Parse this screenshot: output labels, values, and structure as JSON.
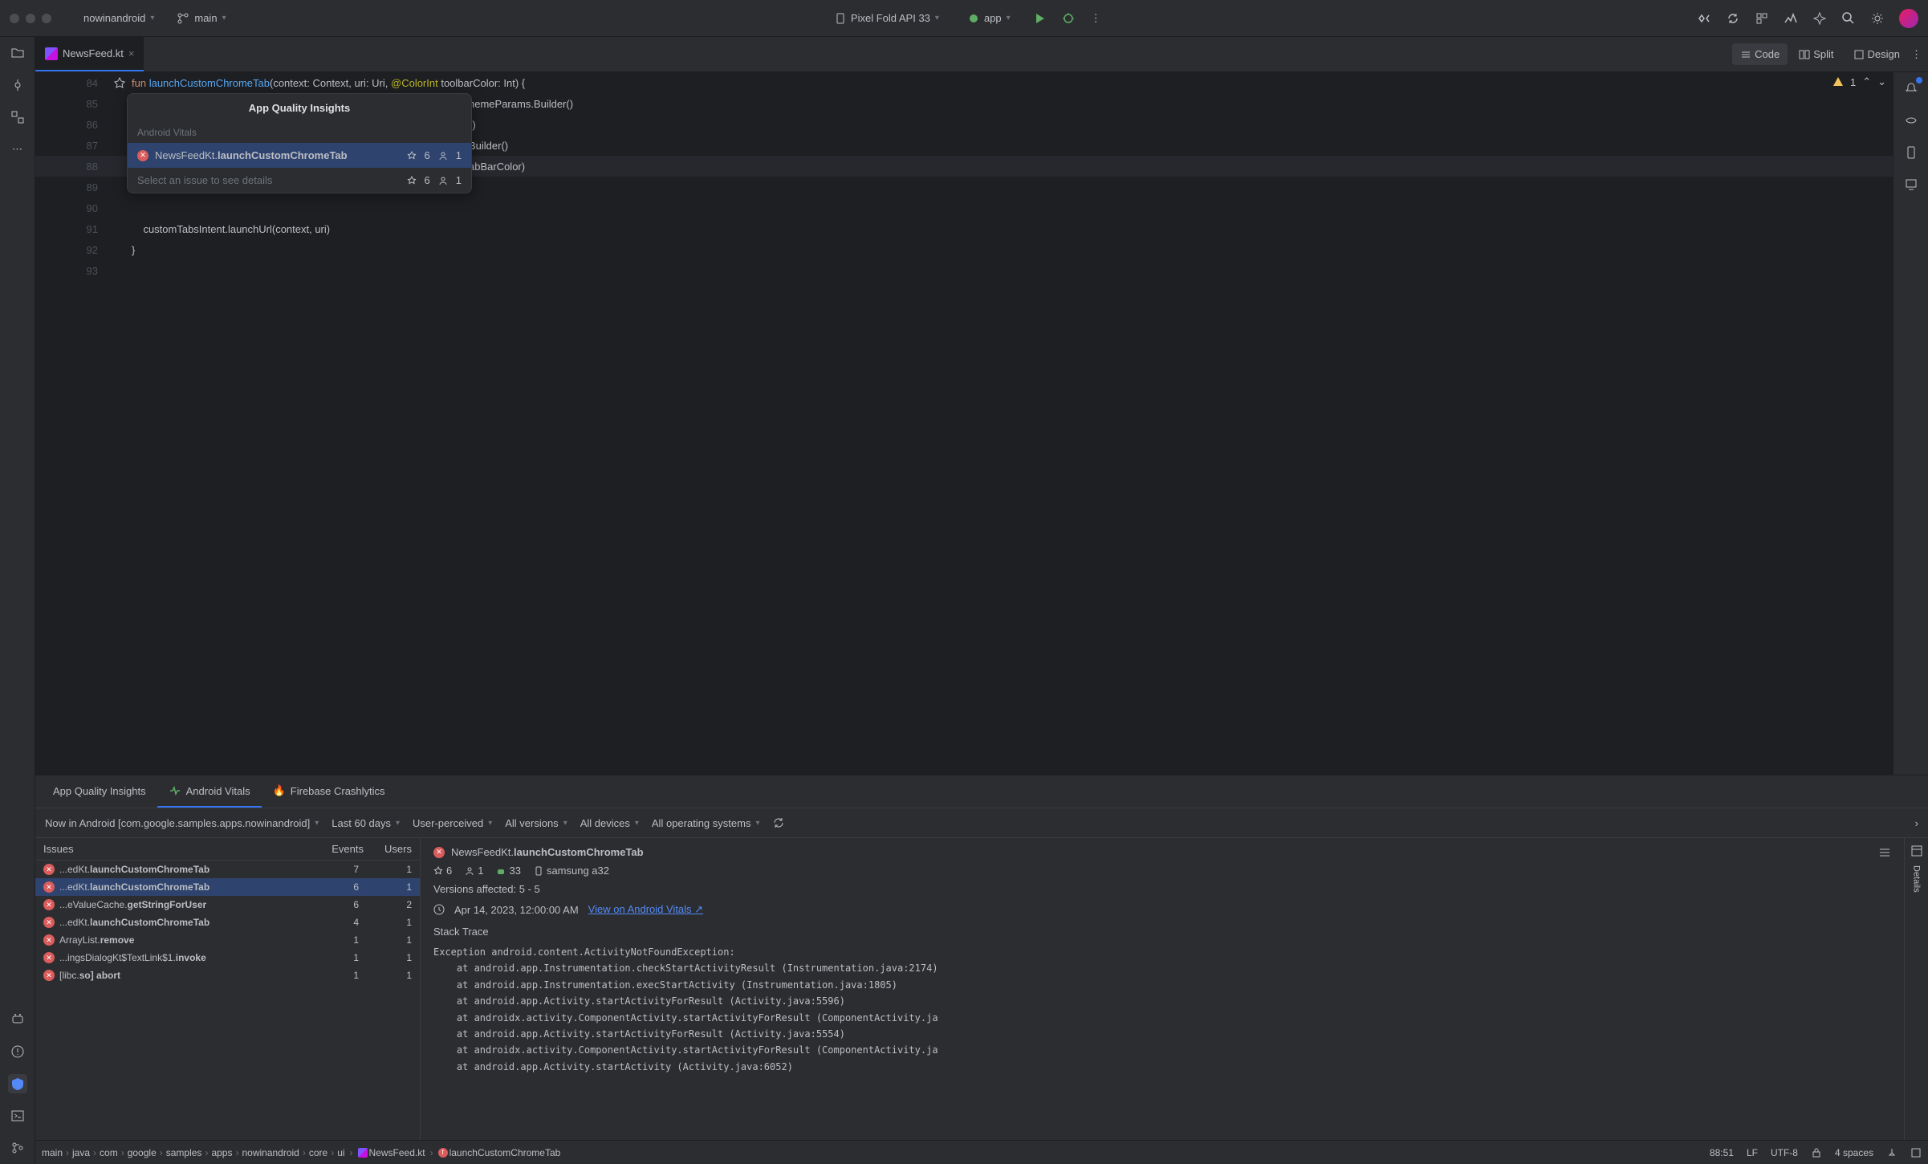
{
  "titlebar": {
    "project": "nowinandroid",
    "branch": "main",
    "device": "Pixel Fold API 33",
    "run_config": "app"
  },
  "file_tab": "NewsFeed.kt",
  "view_modes": {
    "code": "Code",
    "split": "Split",
    "design": "Design"
  },
  "inspection_count": "1",
  "code": {
    "line84": {
      "num": "84",
      "kw": "fun",
      "fn": "launchCustomChromeTab",
      "rest": "(context: Context, uri: Uri, ",
      "ann": "@ColorInt",
      "rest2": " toolbarColor: Int) {"
    },
    "line85": {
      "num": "85",
      "text": "hemeParams.Builder()"
    },
    "line86": {
      "num": "86",
      "text": "()"
    },
    "line87": {
      "num": "87",
      "text": "Builder()"
    },
    "line88": {
      "num": "88",
      "text": "abBarColor)"
    },
    "line89": {
      "num": "89",
      "text": ""
    },
    "line90": {
      "num": "90",
      "text": ""
    },
    "line91": {
      "num": "91",
      "text": "    customTabsIntent.launchUrl(context, uri)"
    },
    "line92": {
      "num": "92",
      "text": "}"
    },
    "line93": {
      "num": "93",
      "text": ""
    }
  },
  "popup": {
    "title": "App Quality Insights",
    "subtitle": "Android Vitals",
    "row1_prefix": "NewsFeedKt.",
    "row1_name": "launchCustomChromeTab",
    "row1_events": "6",
    "row1_users": "1",
    "row2_text": "Select an issue to see details",
    "row2_events": "6",
    "row2_users": "1"
  },
  "panel_tabs": {
    "aqi": "App Quality Insights",
    "vitals": "Android Vitals",
    "crashlytics": "Firebase Crashlytics"
  },
  "filters": {
    "app": "Now in Android [com.google.samples.apps.nowinandroid]",
    "time": "Last 60 days",
    "perception": "User-perceived",
    "versions": "All versions",
    "devices": "All devices",
    "os": "All operating systems"
  },
  "table": {
    "h_issues": "Issues",
    "h_events": "Events",
    "h_users": "Users",
    "rows": [
      {
        "pre": "...edKt.",
        "name": "launchCustomChromeTab",
        "events": "7",
        "users": "1"
      },
      {
        "pre": "...edKt.",
        "name": "launchCustomChromeTab",
        "events": "6",
        "users": "1"
      },
      {
        "pre": "...eValueCache.",
        "name": "getStringForUser",
        "events": "6",
        "users": "2"
      },
      {
        "pre": "...edKt.",
        "name": "launchCustomChromeTab",
        "events": "4",
        "users": "1"
      },
      {
        "pre": "ArrayList.",
        "name": "remove",
        "events": "1",
        "users": "1"
      },
      {
        "pre": "...ingsDialogKt$TextLink$1.",
        "name": "invoke",
        "events": "1",
        "users": "1"
      },
      {
        "pre": "[libc.",
        "name": "so] abort",
        "events": "1",
        "users": "1"
      }
    ]
  },
  "detail": {
    "title_pre": "NewsFeedKt.",
    "title_name": "launchCustomChromeTab",
    "events": "6",
    "users": "1",
    "api": "33",
    "device": "samsung a32",
    "versions": "Versions affected: 5 - 5",
    "date": "Apr 14, 2023, 12:00:00 AM",
    "link": "View on Android Vitals",
    "stack_label": "Stack Trace",
    "trace": "Exception android.content.ActivityNotFoundException:\n    at android.app.Instrumentation.checkStartActivityResult (Instrumentation.java:2174)\n    at android.app.Instrumentation.execStartActivity (Instrumentation.java:1805)\n    at android.app.Activity.startActivityForResult (Activity.java:5596)\n    at androidx.activity.ComponentActivity.startActivityForResult (ComponentActivity.ja\n    at android.app.Activity.startActivityForResult (Activity.java:5554)\n    at androidx.activity.ComponentActivity.startActivityForResult (ComponentActivity.ja\n    at android.app.Activity.startActivity (Activity.java:6052)",
    "side_label": "Details"
  },
  "breadcrumb": {
    "items": [
      "main",
      "java",
      "com",
      "google",
      "samples",
      "apps",
      "nowinandroid",
      "core",
      "ui"
    ],
    "file": "NewsFeed.kt",
    "func": "launchCustomChromeTab"
  },
  "status": {
    "pos": "88:51",
    "le": "LF",
    "enc": "UTF-8",
    "indent": "4 spaces"
  }
}
